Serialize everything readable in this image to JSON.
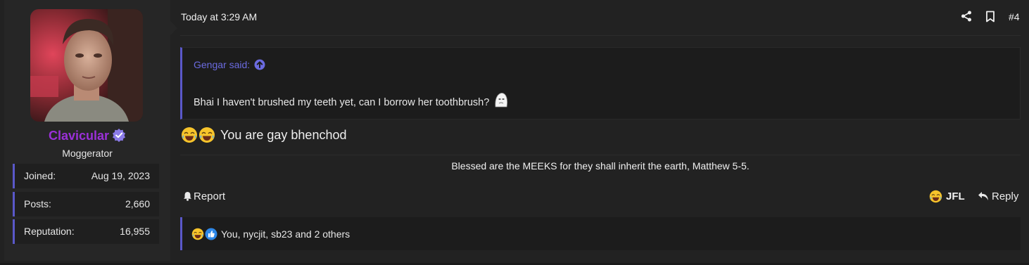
{
  "user": {
    "name": "Clavicular",
    "title": "Moggerator",
    "stats": [
      {
        "label": "Joined:",
        "value": "Aug 19, 2023"
      },
      {
        "label": "Posts:",
        "value": "2,660"
      },
      {
        "label": "Reputation:",
        "value": "16,955"
      }
    ],
    "name_color": "#9b30d9"
  },
  "post": {
    "timestamp": "Today at 3:29 AM",
    "number": "#4",
    "quote": {
      "author": "Gengar said:",
      "text": "Bhai I haven't brushed my teeth yet, can I borrow her toothbrush?"
    },
    "message": "You are gay bhenchod",
    "signature": "Blessed are the MEEKS for they shall inherit the earth, Matthew 5-5."
  },
  "actions": {
    "report": "Report",
    "reaction": "JFL",
    "reply": "Reply"
  },
  "reactions_summary": "You, nycjit, sb23 and 2 others",
  "colors": {
    "accent": "#5a58c9",
    "quote_link": "#6b6be0",
    "background": "#222222"
  },
  "icons": [
    "share-icon",
    "bookmark-icon",
    "arrow-up-circle-icon",
    "bell-icon",
    "reply-icon",
    "laughing-emoji-icon",
    "thumbs-up-icon",
    "verified-badge-icon"
  ]
}
